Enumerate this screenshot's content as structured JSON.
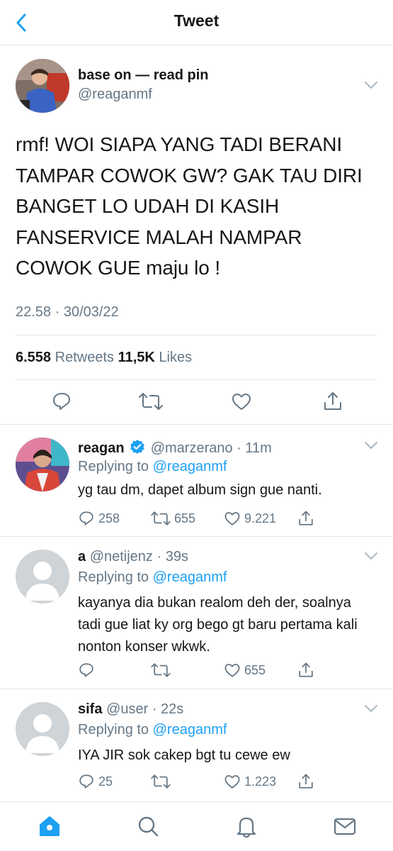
{
  "header": {
    "title": "Tweet"
  },
  "main_tweet": {
    "display_name": "base on — read pin",
    "handle": "@reaganmf",
    "text": "rmf! WOI SIAPA YANG TADI BERANI TAMPAR COWOK GW? GAK TAU DIRI BANGET LO UDAH DI KASIH FANSERVICE MALAH NAMPAR COWOK GUE maju lo !",
    "timestamp": "22.58 · 30/03/22",
    "retweets_count": "6.558",
    "retweets_label": "Retweets",
    "likes_count": "11,5K",
    "likes_label": "Likes"
  },
  "replies": [
    {
      "name": "reagan",
      "verified": true,
      "handle_time": "@marzerano · 11m",
      "replying_prefix": "Replying to",
      "replying_to": "@reaganmf",
      "text": "yg tau dm, dapet album sign gue nanti.",
      "reply_count": "258",
      "retweet_count": "655",
      "like_count": "9.221"
    },
    {
      "name": "a",
      "verified": false,
      "handle_time": "@netijenz · 39s",
      "replying_prefix": "Replying to",
      "replying_to": "@reaganmf",
      "text": "kayanya dia bukan realom deh der, soalnya tadi gue liat ky org bego gt baru pertama kali nonton konser wkwk.",
      "reply_count": "",
      "retweet_count": "",
      "like_count": "655"
    },
    {
      "name": "sifa",
      "verified": false,
      "handle_time": "@user · 22s",
      "replying_prefix": "Replying to",
      "replying_to": "@reaganmf",
      "text": "IYA JIR sok cakep bgt tu cewe ew",
      "reply_count": "25",
      "retweet_count": "",
      "like_count": "1.223"
    }
  ],
  "tabbar": {
    "active": "home",
    "icons": [
      "home-icon",
      "search-icon",
      "bell-icon",
      "mail-icon"
    ]
  },
  "colors": {
    "accent": "#1da1f2",
    "text": "#14171a",
    "muted": "#657786",
    "divider": "#e1e8ed",
    "verified": "#1da1f2"
  }
}
